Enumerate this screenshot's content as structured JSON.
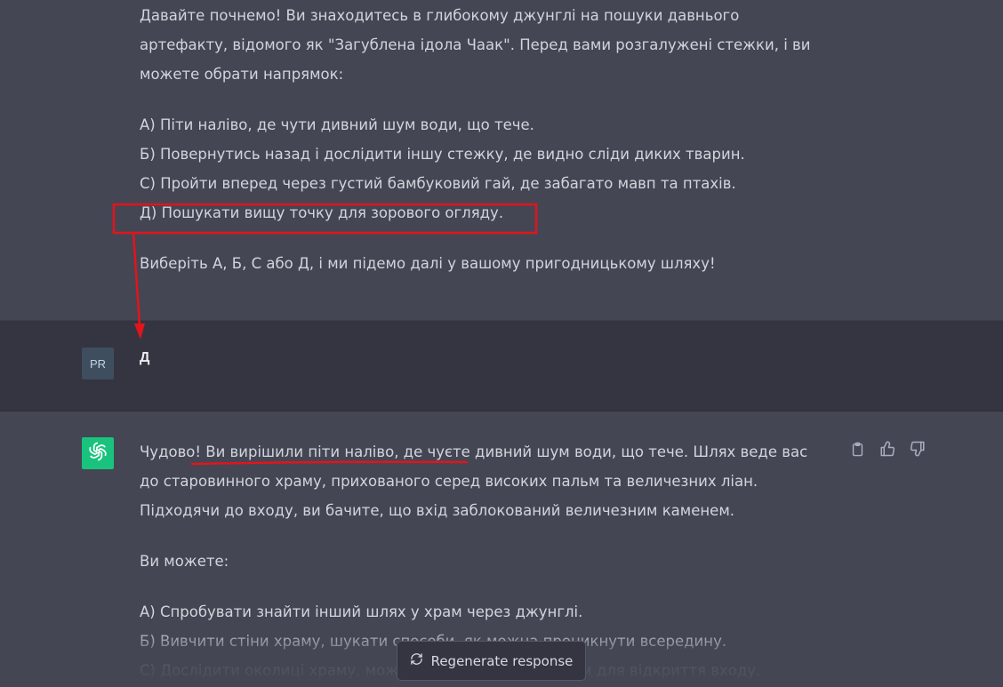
{
  "conversation": {
    "assistant_1": {
      "intro": "Давайте почнемо! Ви знаходитесь в глибокому джунглі на пошуки давнього артефакту, відомого як \"Загублена ідола Чаак\". Перед вами розгалужені стежки, і ви можете обрати напрямок:",
      "options": [
        "А) Піти наліво, де чути дивний шум води, що тече.",
        "Б) Повернутись назад і дослідити іншу стежку, де видно сліди диких тварин.",
        "С) Пройти вперед через густий бамбуковий гай, де забагато мавп та птахів.",
        "Д) Пошукати вищу точку для зорового огляду."
      ],
      "outro": "Виберіть А, Б, С або Д, і ми підемо далі у вашому пригодницькому шляху!"
    },
    "user": {
      "avatar_initials": "PR",
      "text": "Д"
    },
    "assistant_2": {
      "paragraph": "Чудово! Ви вирішили піти наліво, де чуєте дивний шум води, що тече. Шлях веде вас до старовинного храму, прихованого серед високих пальм та величезних ліан. Підходячи до входу, ви бачите, що вхід заблокований величезним каменем.",
      "prompt": "Ви можете:",
      "options": [
        "А) Спробувати знайти інший шлях у храм через джунглі.",
        "Б) Вивчити стіни храму, шукати способи, як можна проникнути всередину.",
        "С) Дослідити околиці храму, можливо, знайдете механізм для відкриття входу."
      ]
    }
  },
  "controls": {
    "regenerate_label": "Regenerate response"
  },
  "icons": {
    "copy": "clipboard-icon",
    "like": "thumbs-up-icon",
    "dislike": "thumbs-down-icon",
    "regen": "refresh-icon",
    "assistant_avatar": "openai-logo-icon"
  },
  "colors": {
    "assistant_bg": "#444654",
    "user_bg": "#343541",
    "assistant_avatar_bg": "#19c37d",
    "annotation_red": "#e3141b"
  }
}
